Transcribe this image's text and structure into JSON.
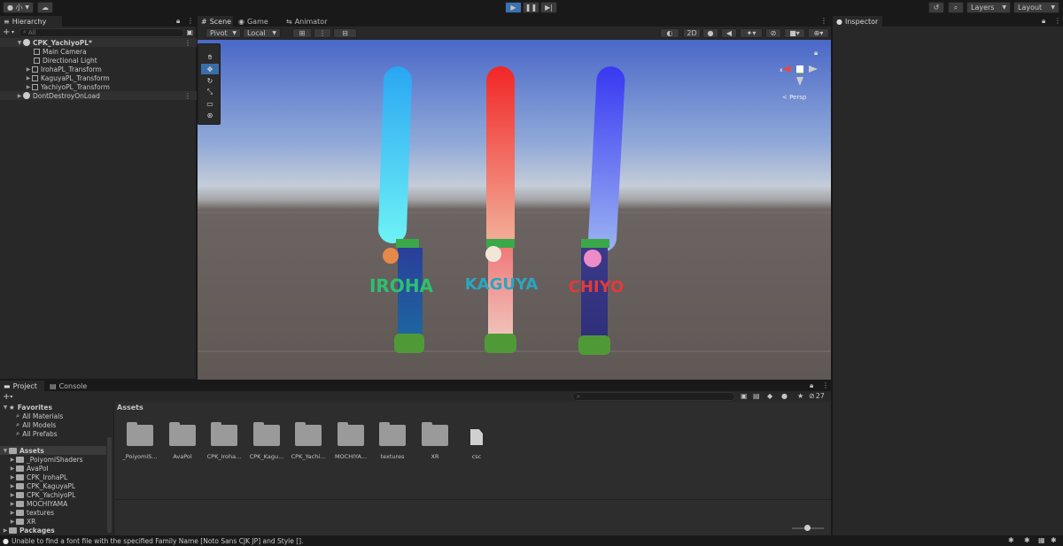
{
  "toolbar": {
    "account_label": "小",
    "layers_label": "Layers",
    "layout_label": "Layout"
  },
  "hierarchy": {
    "tab": "Hierarchy",
    "search_placeholder": "All",
    "items": [
      {
        "label": "CPK_YachiyoPL*"
      },
      {
        "label": "Main Camera"
      },
      {
        "label": "Directional Light"
      },
      {
        "label": "IrohaPL_Transform"
      },
      {
        "label": "KaguyaPL_Transform"
      },
      {
        "label": "YachiyoPL_Transform"
      },
      {
        "label": "DontDestroyOnLoad"
      }
    ]
  },
  "scene": {
    "tabs": [
      {
        "label": "Scene"
      },
      {
        "label": "Game"
      },
      {
        "label": "Animator"
      }
    ],
    "pivot_label": "Pivot",
    "local_label": "Local",
    "mode_2d": "2D",
    "persp_label": "< Persp",
    "glowsticks": [
      {
        "text": "IROHA",
        "top_color": "#2ea8f0",
        "mid_color": "#6af0f8",
        "base_color": "#1a6a98",
        "text_color": "#2fbf6f"
      },
      {
        "text": "KAGUYA",
        "top_color": "#f02a2a",
        "mid_color": "#f0a28c",
        "base_color": "#e87676",
        "text_color": "#2aa6c0"
      },
      {
        "text": "CHIYO",
        "top_color": "#3a3af0",
        "mid_color": "#7c8cf0",
        "base_color": "#3a3a90",
        "text_color": "#e23a3a"
      }
    ]
  },
  "inspector": {
    "tab": "Inspector"
  },
  "project": {
    "tabs": [
      {
        "label": "Project"
      },
      {
        "label": "Console"
      }
    ],
    "hidden_count": "27",
    "breadcrumb": "Assets",
    "favorites": {
      "label": "Favorites",
      "items": [
        {
          "label": "All Materials"
        },
        {
          "label": "All Models"
        },
        {
          "label": "All Prefabs"
        }
      ]
    },
    "assets_root": "Assets",
    "asset_folders": [
      {
        "label": "_PoiyomiShaders"
      },
      {
        "label": "AvaPol"
      },
      {
        "label": "CPK_IrohaPL"
      },
      {
        "label": "CPK_KaguyaPL"
      },
      {
        "label": "CPK_YachiyoPL"
      },
      {
        "label": "MOCHIYAMA"
      },
      {
        "label": "textures"
      },
      {
        "label": "XR"
      }
    ],
    "packages_label": "Packages",
    "grid": [
      {
        "label": "_PoiyomiS...",
        "kind": "folder"
      },
      {
        "label": "AvaPol",
        "kind": "folder"
      },
      {
        "label": "CPK_Iroha...",
        "kind": "folder"
      },
      {
        "label": "CPK_Kagu...",
        "kind": "folder"
      },
      {
        "label": "CPK_Yachi...",
        "kind": "folder"
      },
      {
        "label": "MOCHIYA...",
        "kind": "folder"
      },
      {
        "label": "textures",
        "kind": "folder"
      },
      {
        "label": "XR",
        "kind": "folder"
      },
      {
        "label": "csc",
        "kind": "file"
      }
    ]
  },
  "status": {
    "message": "Unable to find a font file with the specified Family Name [Noto Sans CJK JP] and Style []."
  }
}
